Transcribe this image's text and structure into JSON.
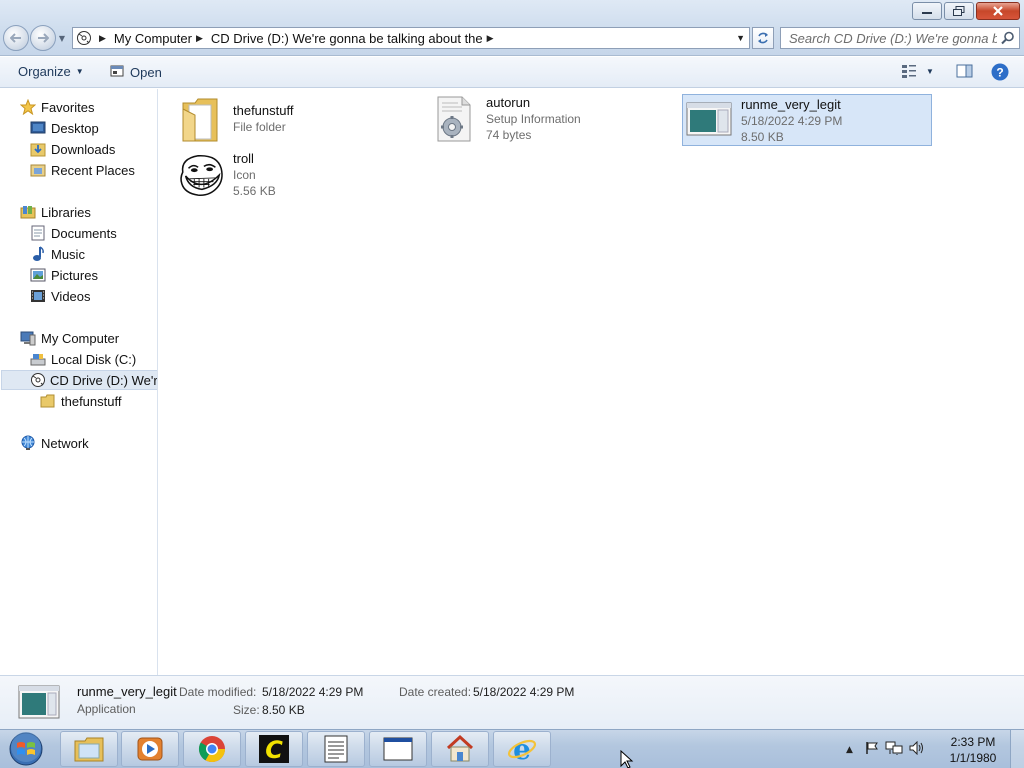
{
  "window": {
    "address_crumbs": [
      "My Computer",
      "CD Drive (D:) We're gonna be talking about the"
    ],
    "search_placeholder": "Search CD Drive (D:) We're gonna be ..."
  },
  "toolbar": {
    "organize_label": "Organize",
    "open_label": "Open"
  },
  "navigation": {
    "favorites": {
      "label": "Favorites",
      "items": [
        "Desktop",
        "Downloads",
        "Recent Places"
      ]
    },
    "libraries": {
      "label": "Libraries",
      "items": [
        "Documents",
        "Music",
        "Pictures",
        "Videos"
      ]
    },
    "computer": {
      "label": "My Computer",
      "items": [
        "Local Disk (C:)",
        "CD Drive (D:) We're g"
      ],
      "subitem": "thefunstuff"
    },
    "network": {
      "label": "Network"
    }
  },
  "files": [
    {
      "name": "thefunstuff",
      "line1": "File folder",
      "line2": "",
      "icon": "folder-icon"
    },
    {
      "name": "autorun",
      "line1": "Setup Information",
      "line2": "74 bytes",
      "icon": "settings-file-icon"
    },
    {
      "name": "runme_very_legit",
      "line1": "5/18/2022 4:29 PM",
      "line2": "8.50 KB",
      "icon": "application-icon",
      "selected": true
    },
    {
      "name": "troll",
      "line1": "Icon",
      "line2": "5.56 KB",
      "icon": "trollface-icon"
    }
  ],
  "details": {
    "name": "runme_very_legit",
    "type": "Application",
    "date_modified_label": "Date modified:",
    "date_modified": "5/18/2022 4:29 PM",
    "size_label": "Size:",
    "size": "8.50 KB",
    "date_created_label": "Date created:",
    "date_created": "5/18/2022 4:29 PM"
  },
  "taskbar": {
    "apps": [
      "file-explorer-icon",
      "media-player-icon",
      "chrome-icon",
      "ccleaner-icon",
      "notepad-icon",
      "window-icon",
      "home-network-icon",
      "internet-explorer-icon"
    ],
    "clock_time": "2:33 PM",
    "clock_date": "1/1/1980"
  },
  "colors": {
    "accent": "#1e395b",
    "selection": "#d7e6f8",
    "taskbar": "#b3c7df"
  }
}
